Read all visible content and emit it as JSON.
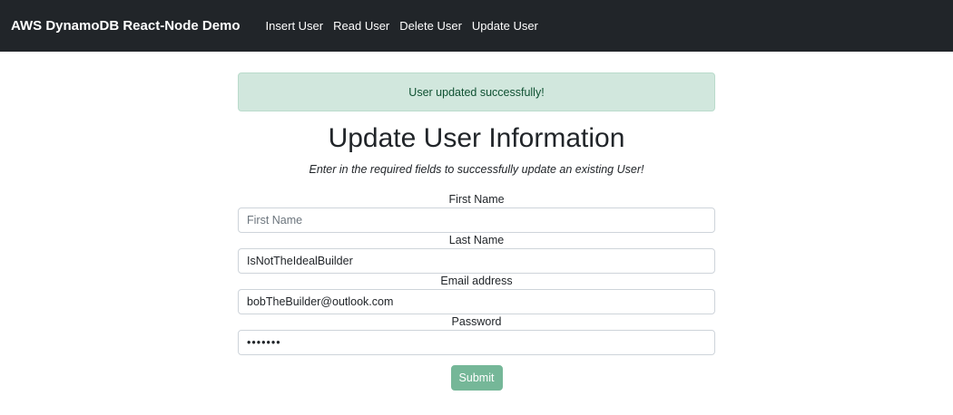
{
  "navbar": {
    "brand": "AWS DynamoDB React-Node Demo",
    "links": [
      "Insert User",
      "Read User",
      "Delete User",
      "Update User"
    ]
  },
  "alert": {
    "message": "User updated successfully!"
  },
  "page": {
    "title": "Update User Information",
    "subtitle": "Enter in the required fields to successfully update an existing User!"
  },
  "form": {
    "first_name": {
      "label": "First Name",
      "placeholder": "First Name",
      "value": ""
    },
    "last_name": {
      "label": "Last Name",
      "value": "IsNotTheIdealBuilder"
    },
    "email": {
      "label": "Email address",
      "value": "bobTheBuilder@outlook.com"
    },
    "password": {
      "label": "Password",
      "value": "1234567"
    },
    "submit_label": "Submit"
  },
  "colors": {
    "navbar_bg": "#212529",
    "alert_bg": "#d1e7dd",
    "submit_bg": "#75b798"
  }
}
